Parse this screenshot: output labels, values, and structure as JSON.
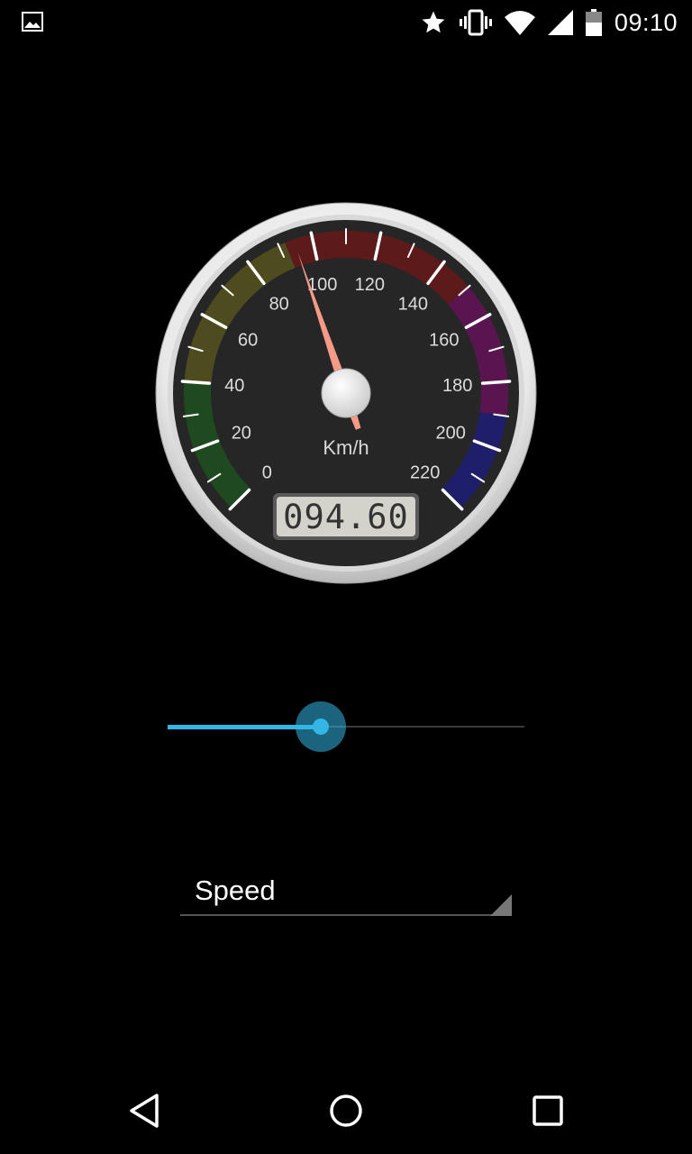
{
  "status_bar": {
    "time": "09:10",
    "icons": [
      "image-notification-icon",
      "star-icon",
      "vibrate-icon",
      "wifi-icon",
      "cell-signal-icon",
      "battery-icon"
    ]
  },
  "gauge": {
    "unit": "Km/h",
    "min": 0,
    "max": 220,
    "value": 94.6,
    "readout": "094.60",
    "tick_labels": [
      "0",
      "20",
      "40",
      "60",
      "80",
      "100",
      "120",
      "140",
      "160",
      "180",
      "200",
      "220"
    ],
    "zones": [
      {
        "from": 0,
        "to": 40,
        "color": "#1f4a1f"
      },
      {
        "from": 40,
        "to": 92,
        "color": "#4e4b1e"
      },
      {
        "from": 92,
        "to": 150,
        "color": "#5c1a1a"
      },
      {
        "from": 150,
        "to": 190,
        "color": "#5a1550"
      },
      {
        "from": 190,
        "to": 220,
        "color": "#1e1e6a"
      }
    ],
    "needle_color": "#f49a86",
    "dial_color": "#262626"
  },
  "slider": {
    "fraction": 0.43,
    "accent": "#33b5e5"
  },
  "spinner": {
    "selected": "Speed"
  },
  "nav_bar": {
    "buttons": [
      "back-icon",
      "home-icon",
      "recents-icon"
    ]
  }
}
